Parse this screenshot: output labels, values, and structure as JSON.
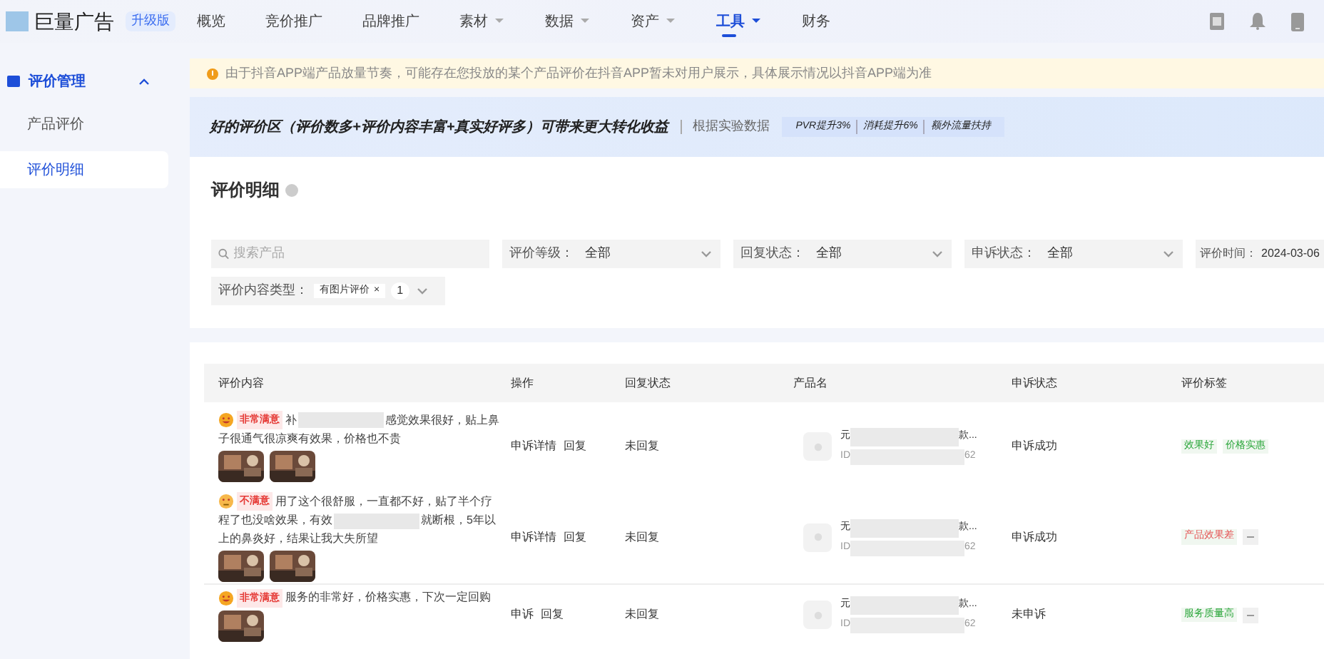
{
  "brand": {
    "name": "巨量广告",
    "badge": "升级版"
  },
  "nav": [
    {
      "label": "概览",
      "dropdown": false,
      "selected": false
    },
    {
      "label": "竞价推广",
      "dropdown": false,
      "selected": false
    },
    {
      "label": "品牌推广",
      "dropdown": false,
      "selected": false
    },
    {
      "label": "素材",
      "dropdown": true,
      "selected": false
    },
    {
      "label": "数据",
      "dropdown": true,
      "selected": false
    },
    {
      "label": "资产",
      "dropdown": true,
      "selected": false
    },
    {
      "label": "工具",
      "dropdown": true,
      "selected": true
    },
    {
      "label": "财务",
      "dropdown": false,
      "selected": false
    }
  ],
  "sidebar": {
    "group": "评价管理",
    "expanded": true,
    "items": [
      {
        "label": "产品评价",
        "selected": false
      },
      {
        "label": "评价明细",
        "selected": true
      }
    ]
  },
  "notice": "由于抖音APP端产品放量节奏，可能存在您投放的某个产品评价在抖音APP暂未对用户展示，具体展示情况以抖音APP端为准",
  "banner": {
    "headline": "好的评价区（评价数多+评价内容丰富+真实好评多）可带来更大转化收益",
    "source": "根据实验数据",
    "stats": [
      "PVR提升3%",
      "消耗提升6%",
      "额外流量扶持"
    ]
  },
  "filters": {
    "title": "评价明细",
    "search_placeholder": "搜索产品",
    "selects": [
      {
        "label": "评价等级：",
        "value": "全部"
      },
      {
        "label": "回复状态：",
        "value": "全部"
      },
      {
        "label": "申诉状态：",
        "value": "全部"
      }
    ],
    "date": {
      "label": "评价时间：",
      "value": "2024-03-06"
    },
    "content_type": {
      "label": "评价内容类型：",
      "tag": "有图片评价",
      "tag_close": "×",
      "count": "1"
    }
  },
  "table": {
    "columns": [
      "评价内容",
      "操作",
      "回复状态",
      "产品名",
      "申诉状态",
      "评价标签"
    ],
    "rows": [
      {
        "face": {
          "kind": "grin"
        },
        "rating": "非常满意",
        "review": [
          {
            "kind": "text",
            "text": "补"
          },
          {
            "kind": "blur"
          },
          {
            "kind": "text",
            "text": "感觉效果很好，贴上鼻子很通气很凉爽有效果，价格也不贵"
          }
        ],
        "images": [
          {
            "kind": "picture"
          },
          {
            "kind": "picture"
          }
        ],
        "actions": [
          "申诉详情",
          "回复"
        ],
        "reply_status": "未回复",
        "product_name": [
          "元",
          "款..."
        ],
        "product_id": [
          "ID",
          "62"
        ],
        "appeal_status": "申诉成功",
        "tags": [
          {
            "text": "效果好",
            "color": "#2aa63a"
          },
          {
            "text": "价格实惠",
            "color": "#2aa63a"
          }
        ],
        "more": false
      },
      {
        "face": {
          "kind": "frown"
        },
        "rating": "不满意",
        "review": [
          {
            "kind": "text",
            "text": "用了这个很舒服，一直都不好，贴了半个疗程了也没啥效果，有效"
          },
          {
            "kind": "blur"
          },
          {
            "kind": "text",
            "text": "就断根，5年以上的鼻炎好，结果让我大失所望"
          }
        ],
        "images": [
          {
            "kind": "picture"
          },
          {
            "kind": "picture"
          }
        ],
        "actions": [
          "申诉详情",
          "回复"
        ],
        "reply_status": "未回复",
        "product_name": [
          "无",
          "款..."
        ],
        "product_id": [
          "ID",
          "62"
        ],
        "appeal_status": "申诉成功",
        "tags": [
          {
            "text": "产品效果差",
            "color": "#e55555"
          }
        ],
        "more": true
      },
      {
        "face": {
          "kind": "grin"
        },
        "rating": "非常满意",
        "review": [
          {
            "kind": "text",
            "text": "服务的非常好，价格实惠，下次一定回购"
          }
        ],
        "images": [
          {
            "kind": "picture"
          }
        ],
        "actions": [
          "申诉",
          "回复"
        ],
        "reply_status": "未回复",
        "product_name": [
          "元",
          "款..."
        ],
        "product_id": [
          "ID",
          "62"
        ],
        "appeal_status": "未申诉",
        "tags": [
          {
            "text": "服务质量高",
            "color": "#2aa63a"
          }
        ],
        "more": true
      }
    ]
  }
}
